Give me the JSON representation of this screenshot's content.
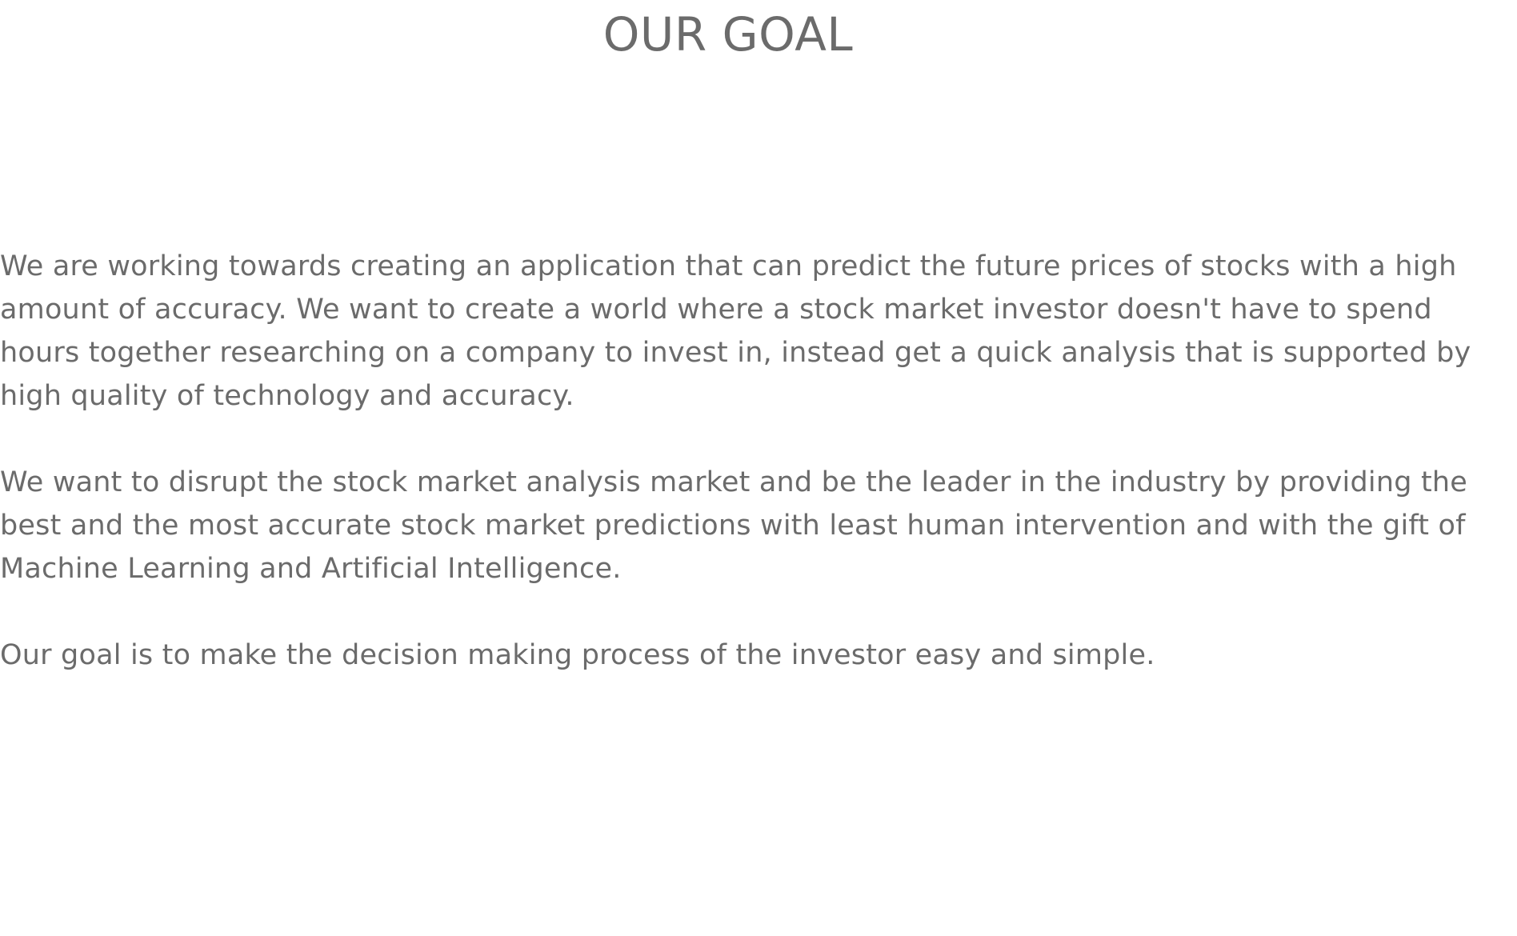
{
  "page": {
    "title": "OUR GOAL",
    "paragraphs": [
      "We are working towards creating an application that can predict the future prices of stocks with a high amount of accuracy. We want to create a world where a stock market investor doesn't have to spend hours together researching on a company to invest in, instead get a quick analysis that is supported by high quality of technology and accuracy.",
      "We want to disrupt the stock market analysis market and be the leader in the industry by providing the best and the most accurate stock market predictions with least human intervention and with the gift of Machine Learning and Artificial Intelligence.",
      "Our goal is to make the decision making process of the investor easy and simple."
    ]
  },
  "colors": {
    "text": "#6b6b6b",
    "background": "#ffffff"
  }
}
